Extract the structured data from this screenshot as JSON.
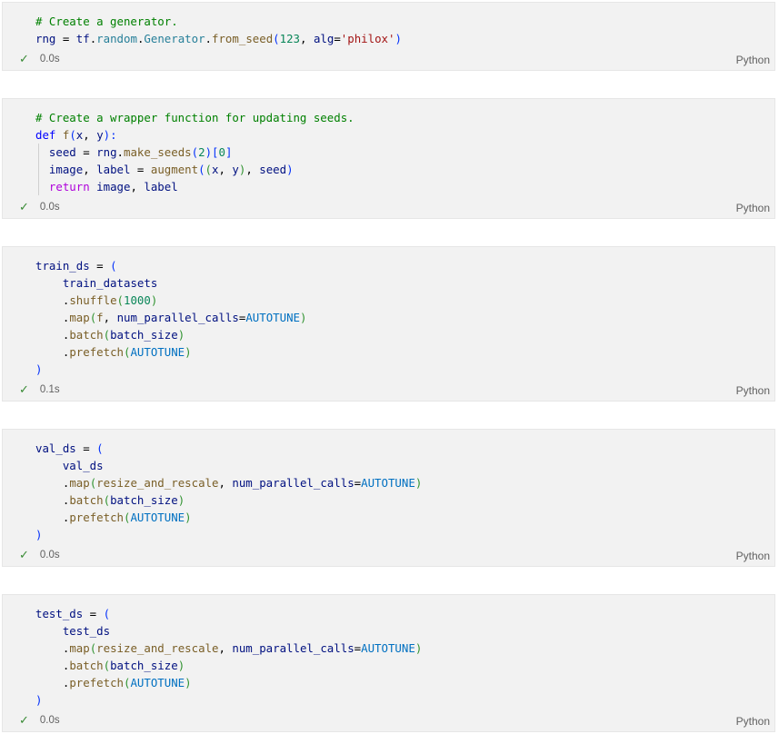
{
  "cells": [
    {
      "lines": [
        [
          {
            "t": "# Create a generator.",
            "c": "comment"
          }
        ],
        [
          {
            "t": "rng",
            "c": "var"
          },
          {
            "t": " = ",
            "c": "op"
          },
          {
            "t": "tf",
            "c": "var"
          },
          {
            "t": ".",
            "c": "op"
          },
          {
            "t": "random",
            "c": "cls"
          },
          {
            "t": ".",
            "c": "op"
          },
          {
            "t": "Generator",
            "c": "cls"
          },
          {
            "t": ".",
            "c": "op"
          },
          {
            "t": "from_seed",
            "c": "fn"
          },
          {
            "t": "(",
            "c": "p1"
          },
          {
            "t": "123",
            "c": "num"
          },
          {
            "t": ", ",
            "c": "op"
          },
          {
            "t": "alg",
            "c": "var"
          },
          {
            "t": "=",
            "c": "op"
          },
          {
            "t": "'philox'",
            "c": "str"
          },
          {
            "t": ")",
            "c": "p1"
          }
        ]
      ],
      "status": {
        "time": "0.0s",
        "language": "Python"
      }
    },
    {
      "lines": [
        [
          {
            "t": "# Create a wrapper function for updating seeds.",
            "c": "comment"
          }
        ],
        [
          {
            "t": "def",
            "c": "kw"
          },
          {
            "t": " ",
            "c": "op"
          },
          {
            "t": "f",
            "c": "fn"
          },
          {
            "t": "(",
            "c": "p1"
          },
          {
            "t": "x",
            "c": "var"
          },
          {
            "t": ", ",
            "c": "op"
          },
          {
            "t": "y",
            "c": "var"
          },
          {
            "t": "):",
            "c": "p1"
          }
        ],
        [
          {
            "t": "  ",
            "c": "op"
          },
          {
            "t": "seed",
            "c": "var"
          },
          {
            "t": " = ",
            "c": "op"
          },
          {
            "t": "rng",
            "c": "var"
          },
          {
            "t": ".",
            "c": "op"
          },
          {
            "t": "make_seeds",
            "c": "fn"
          },
          {
            "t": "(",
            "c": "p1"
          },
          {
            "t": "2",
            "c": "num"
          },
          {
            "t": ")",
            "c": "p1"
          },
          {
            "t": "[",
            "c": "p1"
          },
          {
            "t": "0",
            "c": "num"
          },
          {
            "t": "]",
            "c": "p1"
          }
        ],
        [
          {
            "t": "  ",
            "c": "op"
          },
          {
            "t": "image",
            "c": "var"
          },
          {
            "t": ", ",
            "c": "op"
          },
          {
            "t": "label",
            "c": "var"
          },
          {
            "t": " = ",
            "c": "op"
          },
          {
            "t": "augment",
            "c": "fn"
          },
          {
            "t": "(",
            "c": "p1"
          },
          {
            "t": "(",
            "c": "p2"
          },
          {
            "t": "x",
            "c": "var"
          },
          {
            "t": ", ",
            "c": "op"
          },
          {
            "t": "y",
            "c": "var"
          },
          {
            "t": ")",
            "c": "p2"
          },
          {
            "t": ", ",
            "c": "op"
          },
          {
            "t": "seed",
            "c": "var"
          },
          {
            "t": ")",
            "c": "p1"
          }
        ],
        [
          {
            "t": "  ",
            "c": "op"
          },
          {
            "t": "return",
            "c": "ctl"
          },
          {
            "t": " ",
            "c": "op"
          },
          {
            "t": "image",
            "c": "var"
          },
          {
            "t": ", ",
            "c": "op"
          },
          {
            "t": "label",
            "c": "var"
          }
        ]
      ],
      "status": {
        "time": "0.0s",
        "language": "Python"
      }
    },
    {
      "lines": [
        [
          {
            "t": "train_ds",
            "c": "var"
          },
          {
            "t": " = ",
            "c": "op"
          },
          {
            "t": "(",
            "c": "p1"
          }
        ],
        [
          {
            "t": "    ",
            "c": "op"
          },
          {
            "t": "train_datasets",
            "c": "var"
          }
        ],
        [
          {
            "t": "    .",
            "c": "op"
          },
          {
            "t": "shuffle",
            "c": "fn"
          },
          {
            "t": "(",
            "c": "p2"
          },
          {
            "t": "1000",
            "c": "num"
          },
          {
            "t": ")",
            "c": "p2"
          }
        ],
        [
          {
            "t": "    .",
            "c": "op"
          },
          {
            "t": "map",
            "c": "fn"
          },
          {
            "t": "(",
            "c": "p2"
          },
          {
            "t": "f",
            "c": "fn"
          },
          {
            "t": ", ",
            "c": "op"
          },
          {
            "t": "num_parallel_calls",
            "c": "var"
          },
          {
            "t": "=",
            "c": "op"
          },
          {
            "t": "AUTOTUNE",
            "c": "const"
          },
          {
            "t": ")",
            "c": "p2"
          }
        ],
        [
          {
            "t": "    .",
            "c": "op"
          },
          {
            "t": "batch",
            "c": "fn"
          },
          {
            "t": "(",
            "c": "p2"
          },
          {
            "t": "batch_size",
            "c": "var"
          },
          {
            "t": ")",
            "c": "p2"
          }
        ],
        [
          {
            "t": "    .",
            "c": "op"
          },
          {
            "t": "prefetch",
            "c": "fn"
          },
          {
            "t": "(",
            "c": "p2"
          },
          {
            "t": "AUTOTUNE",
            "c": "const"
          },
          {
            "t": ")",
            "c": "p2"
          }
        ],
        [
          {
            "t": ")",
            "c": "p1"
          }
        ]
      ],
      "status": {
        "time": "0.1s",
        "language": "Python"
      }
    },
    {
      "lines": [
        [
          {
            "t": "val_ds",
            "c": "var"
          },
          {
            "t": " = ",
            "c": "op"
          },
          {
            "t": "(",
            "c": "p1"
          }
        ],
        [
          {
            "t": "    ",
            "c": "op"
          },
          {
            "t": "val_ds",
            "c": "var"
          }
        ],
        [
          {
            "t": "    .",
            "c": "op"
          },
          {
            "t": "map",
            "c": "fn"
          },
          {
            "t": "(",
            "c": "p2"
          },
          {
            "t": "resize_and_rescale",
            "c": "fn"
          },
          {
            "t": ", ",
            "c": "op"
          },
          {
            "t": "num_parallel_calls",
            "c": "var"
          },
          {
            "t": "=",
            "c": "op"
          },
          {
            "t": "AUTOTUNE",
            "c": "const"
          },
          {
            "t": ")",
            "c": "p2"
          }
        ],
        [
          {
            "t": "    .",
            "c": "op"
          },
          {
            "t": "batch",
            "c": "fn"
          },
          {
            "t": "(",
            "c": "p2"
          },
          {
            "t": "batch_size",
            "c": "var"
          },
          {
            "t": ")",
            "c": "p2"
          }
        ],
        [
          {
            "t": "    .",
            "c": "op"
          },
          {
            "t": "prefetch",
            "c": "fn"
          },
          {
            "t": "(",
            "c": "p2"
          },
          {
            "t": "AUTOTUNE",
            "c": "const"
          },
          {
            "t": ")",
            "c": "p2"
          }
        ],
        [
          {
            "t": ")",
            "c": "p1"
          }
        ]
      ],
      "status": {
        "time": "0.0s",
        "language": "Python"
      }
    },
    {
      "lines": [
        [
          {
            "t": "test_ds",
            "c": "var"
          },
          {
            "t": " = ",
            "c": "op"
          },
          {
            "t": "(",
            "c": "p1"
          }
        ],
        [
          {
            "t": "    ",
            "c": "op"
          },
          {
            "t": "test_ds",
            "c": "var"
          }
        ],
        [
          {
            "t": "    .",
            "c": "op"
          },
          {
            "t": "map",
            "c": "fn"
          },
          {
            "t": "(",
            "c": "p2"
          },
          {
            "t": "resize_and_rescale",
            "c": "fn"
          },
          {
            "t": ", ",
            "c": "op"
          },
          {
            "t": "num_parallel_calls",
            "c": "var"
          },
          {
            "t": "=",
            "c": "op"
          },
          {
            "t": "AUTOTUNE",
            "c": "const"
          },
          {
            "t": ")",
            "c": "p2"
          }
        ],
        [
          {
            "t": "    .",
            "c": "op"
          },
          {
            "t": "batch",
            "c": "fn"
          },
          {
            "t": "(",
            "c": "p2"
          },
          {
            "t": "batch_size",
            "c": "var"
          },
          {
            "t": ")",
            "c": "p2"
          }
        ],
        [
          {
            "t": "    .",
            "c": "op"
          },
          {
            "t": "prefetch",
            "c": "fn"
          },
          {
            "t": "(",
            "c": "p2"
          },
          {
            "t": "AUTOTUNE",
            "c": "const"
          },
          {
            "t": ")",
            "c": "p2"
          }
        ],
        [
          {
            "t": ")",
            "c": "p1"
          }
        ]
      ],
      "status": {
        "time": "0.0s",
        "language": "Python"
      }
    }
  ],
  "icons": {
    "success": "checkmark-icon"
  },
  "colors": {
    "cell_background": "#f2f2f2",
    "comment": "#008000",
    "keyword": "#0000ff",
    "control": "#af00db",
    "function": "#795e26",
    "number": "#098658",
    "string": "#a31515",
    "constant": "#0070c1",
    "success": "#388a34"
  }
}
